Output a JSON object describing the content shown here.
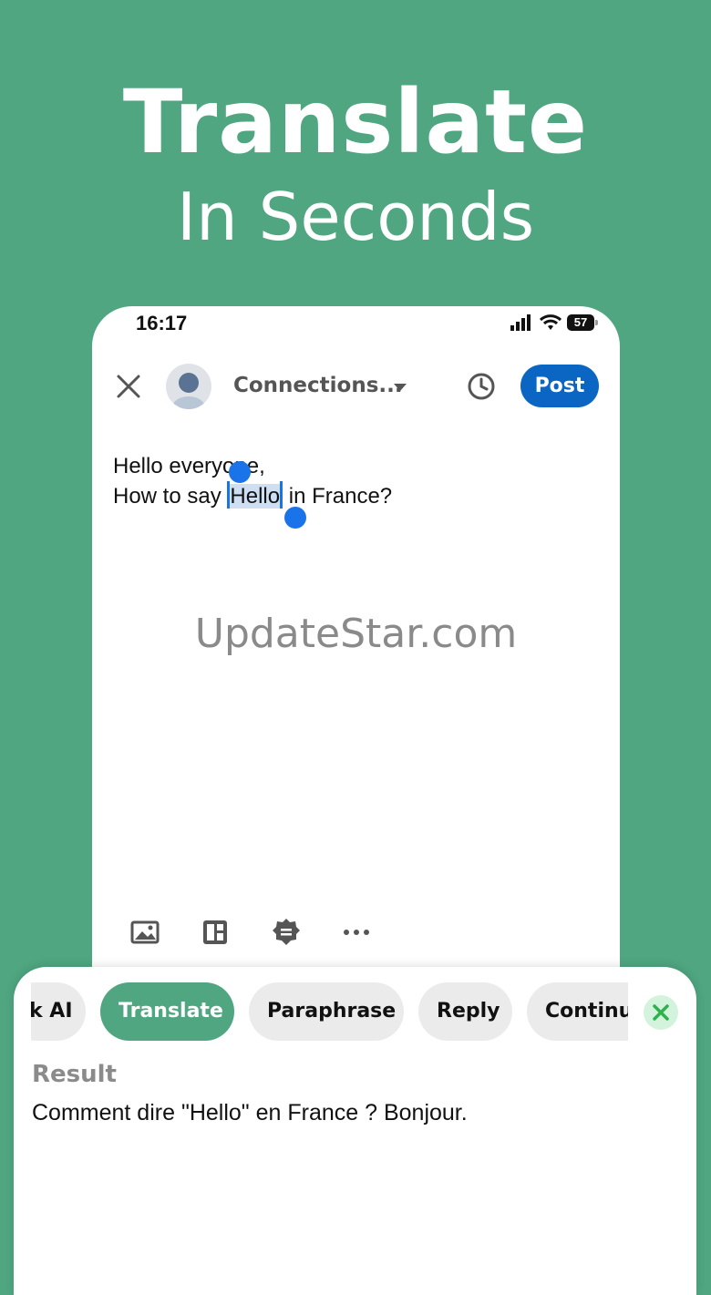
{
  "hero": {
    "title": "Translate",
    "subtitle": "In Seconds"
  },
  "status_bar": {
    "time": "16:17",
    "battery": "57"
  },
  "compose": {
    "audience": "Connections...",
    "post_label": "Post",
    "line1": "Hello everyone,",
    "line2_before": "How to say ",
    "line2_selected": "Hello",
    "line2_after": " in France?"
  },
  "watermark": "UpdateStar.com",
  "ai_actions": {
    "chips": [
      "k AI",
      "Translate",
      "Paraphrase",
      "Reply",
      "Continu"
    ],
    "active": "Translate"
  },
  "result": {
    "label": "Result",
    "text": "Comment dire \"Hello\" en France ? Bonjour."
  },
  "colors": {
    "background": "#4fa681",
    "accent": "#0a66c2",
    "selection": "#1a73e8"
  }
}
